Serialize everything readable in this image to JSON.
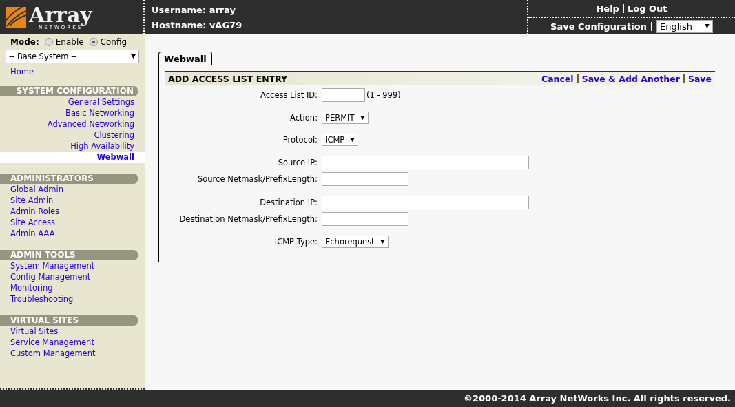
{
  "logo": {
    "name": "Array",
    "tagline": "NETWORKS"
  },
  "header": {
    "username": "Username: array",
    "hostname": "Hostname: vAG79",
    "links": [
      "Help",
      "Log Out"
    ],
    "save": "Save Configuration",
    "language": "English"
  },
  "mode": {
    "label": "Mode:",
    "options": [
      {
        "label": "Enable",
        "selected": false
      },
      {
        "label": "Config",
        "selected": true
      }
    ]
  },
  "scope": "-- Base System --",
  "home": "Home",
  "sections": [
    {
      "title": "SYSTEM CONFIGURATION",
      "kind": "right",
      "items": [
        {
          "label": "General Settings",
          "selected": false
        },
        {
          "label": "Basic Networking",
          "selected": false
        },
        {
          "label": "Advanced Networking",
          "selected": false
        },
        {
          "label": "Clustering",
          "selected": false
        },
        {
          "label": "High Availability",
          "selected": false
        },
        {
          "label": "Webwall",
          "selected": true
        }
      ]
    },
    {
      "title": "ADMINISTRATORS",
      "kind": "left",
      "items": [
        {
          "label": "Global Admin",
          "selected": false
        },
        {
          "label": "Site Admin",
          "selected": false
        },
        {
          "label": "Admin Roles",
          "selected": false
        },
        {
          "label": "Site Access",
          "selected": false
        },
        {
          "label": "Admin AAA",
          "selected": false
        }
      ]
    },
    {
      "title": "ADMIN TOOLS",
      "kind": "left",
      "items": [
        {
          "label": "System Management",
          "selected": false
        },
        {
          "label": "Config Management",
          "selected": false
        },
        {
          "label": "Monitoring",
          "selected": false
        },
        {
          "label": "Troubleshooting",
          "selected": false
        }
      ]
    },
    {
      "title": "VIRTUAL SITES",
      "kind": "left",
      "items": [
        {
          "label": "Virtual Sites",
          "selected": false
        },
        {
          "label": "Service Management",
          "selected": false
        },
        {
          "label": "Custom Management",
          "selected": false
        }
      ]
    }
  ],
  "tab": "Webwall",
  "form": {
    "title": "ADD ACCESS LIST ENTRY",
    "actions": [
      "Cancel",
      "Save & Add Another",
      "Save"
    ],
    "groups": [
      [
        {
          "label": "Access List ID:",
          "kind": "narrow-field",
          "hint": "(1 - 999)"
        }
      ],
      [
        {
          "label": "Action:",
          "kind": "select",
          "value": "PERMIT"
        }
      ],
      [
        {
          "label": "Protocol:",
          "kind": "select",
          "value": "ICMP"
        }
      ],
      [
        {
          "label": "Source IP:",
          "kind": "wide-field"
        },
        {
          "label": "Source Netmask/PrefixLength:",
          "kind": "medium-field"
        }
      ],
      [
        {
          "label": "Destination IP:",
          "kind": "wide-field"
        },
        {
          "label": "Destination Netmask/PrefixLength:",
          "kind": "medium-field"
        }
      ],
      [
        {
          "label": "ICMP Type:",
          "kind": "select",
          "value": "Echorequest"
        }
      ]
    ]
  },
  "footer": "©2000-2014 Array NetWorks Inc. All rights reserved."
}
